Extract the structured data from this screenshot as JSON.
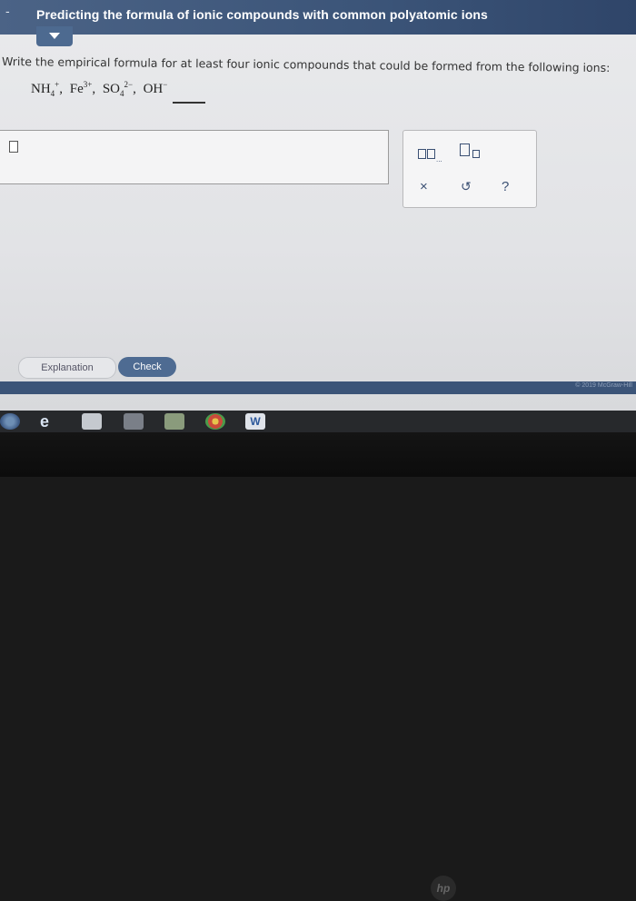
{
  "header": {
    "dash": "-",
    "title": "Predicting the formula of ionic compounds with common polyatomic ions"
  },
  "question": {
    "instructions": "Write the empirical formula for at least four ionic compounds that could be formed from the following ions:",
    "ions": [
      {
        "base": "NH",
        "sub": "4",
        "sup": "+"
      },
      {
        "base": "Fe",
        "sub": "",
        "sup": "3+"
      },
      {
        "base": "SO",
        "sub": "4",
        "sup": "2−"
      },
      {
        "base": "OH",
        "sub": "",
        "sup": "−"
      }
    ],
    "separator": ","
  },
  "tools": {
    "icons": [
      "chemical-formula-icon",
      "subscript-icon"
    ],
    "chem_dots": "...",
    "clear_label": "×",
    "undo_label": "↺",
    "help_label": "?"
  },
  "buttons": {
    "explanation": "Explanation",
    "check": "Check"
  },
  "footer": {
    "copyright": "© 2019 McGraw-Hill"
  },
  "taskbar": {
    "icons": [
      "windows-icon",
      "edge-icon",
      "file-explorer-icon",
      "media-icon",
      "photos-icon",
      "chrome-icon",
      "word-icon"
    ],
    "word_label": "W"
  },
  "bezel": {
    "logo": "hp"
  },
  "colors": {
    "header": "#3b5478",
    "accent": "#4e6b92",
    "background": "#e6e7ea"
  }
}
